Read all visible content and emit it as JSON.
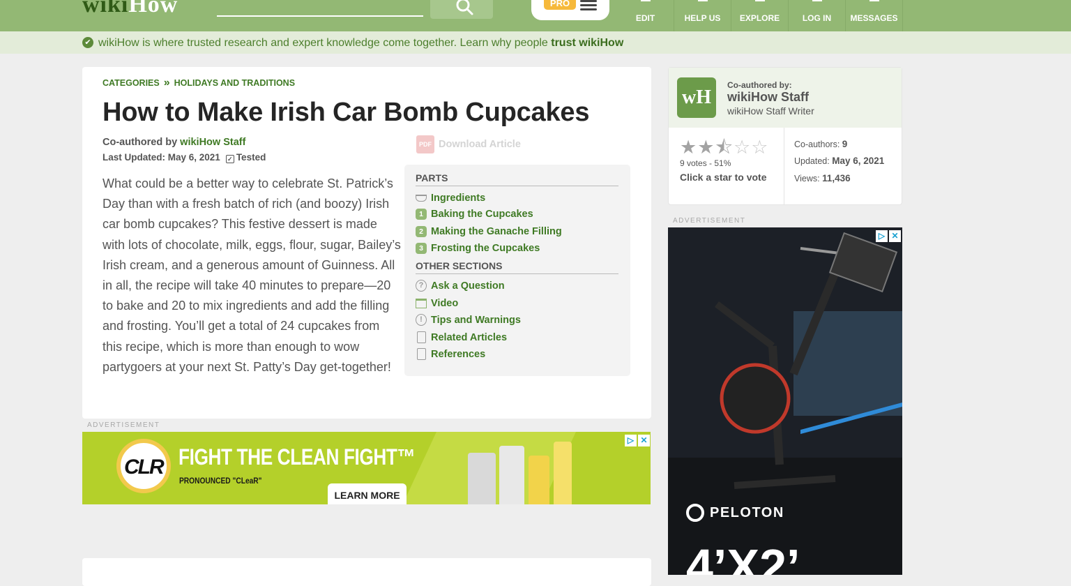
{
  "header": {
    "logo_part1": "wiki",
    "logo_part2": "How",
    "pro_badge": "PRO",
    "nav": [
      "EDIT",
      "HELP US",
      "EXPLORE",
      "LOG IN",
      "MESSAGES"
    ]
  },
  "trust": {
    "text": "wikiHow is where trusted research and expert knowledge come together. Learn why people ",
    "link": "trust wikiHow"
  },
  "breadcrumb": [
    "CATEGORIES",
    "HOLIDAYS AND TRADITIONS"
  ],
  "breadcrumb_sep": "»",
  "article": {
    "title": "How to Make Irish Car Bomb Cupcakes",
    "coauthored_prefix": "Co-authored by ",
    "author": "wikiHow Staff",
    "updated": "Last Updated: May 6, 2021",
    "tested": "Tested",
    "download": "Download Article",
    "pdf": "PDF",
    "intro": "What could be a better way to celebrate St. Patrick’s Day than with a fresh batch of rich (and boozy) Irish car bomb cupcakes? This festive dessert is made with lots of chocolate, milk, eggs, flour, sugar, Bailey’s Irish cream, and a generous amount of Guinness. All in all, the recipe will take 40 minutes to prepare—20 to bake and 20 to mix ingredients and add the filling and frosting. You’ll get a total of 24 cupcakes from this recipe, which is more than enough to wow partygoers at your next St. Patty’s Day get-together!"
  },
  "toc": {
    "parts_heading": "PARTS",
    "ingredients": "Ingredients",
    "parts": [
      {
        "num": "1",
        "label": "Baking the Cupcakes"
      },
      {
        "num": "2",
        "label": "Making the Ganache Filling"
      },
      {
        "num": "3",
        "label": "Frosting the Cupcakes"
      }
    ],
    "other_heading": "OTHER SECTIONS",
    "other": [
      {
        "icon": "question-icon",
        "label": "Ask a Question"
      },
      {
        "icon": "video-icon",
        "label": "Video"
      },
      {
        "icon": "warning-icon",
        "label": "Tips and Warnings"
      },
      {
        "icon": "document-icon",
        "label": "Related Articles"
      },
      {
        "icon": "references-icon",
        "label": "References"
      }
    ]
  },
  "ads": {
    "label": "ADVERTISEMENT",
    "clr_logo": "CLR",
    "clr_headline": "FIGHT THE CLEAN FIGHT™",
    "clr_sub": "PRONOUNCED \"CLeaR\"",
    "clr_button": "LEARN MORE",
    "peloton_brand": "PELOTON",
    "peloton_big": "4’X2’"
  },
  "sidebar": {
    "coauthored_label": "Co-authored by:",
    "name": "wikiHow Staff",
    "role": "wikiHow Staff Writer",
    "logo_text": "wH",
    "rating": {
      "value": 2.5,
      "max": 5
    },
    "votes": "9 votes - 51%",
    "vote_cta": "Click a star to vote",
    "coauthors_label": "Co-authors: ",
    "coauthors": "9",
    "updated_label": "Updated: ",
    "updated": "May 6, 2021",
    "views_label": "Views: ",
    "views": "11,436"
  },
  "colors": {
    "header": "#93b874",
    "link": "#3f7a24",
    "trustbar": "#e3ecd9",
    "clr_ad": "#b4d02a"
  }
}
